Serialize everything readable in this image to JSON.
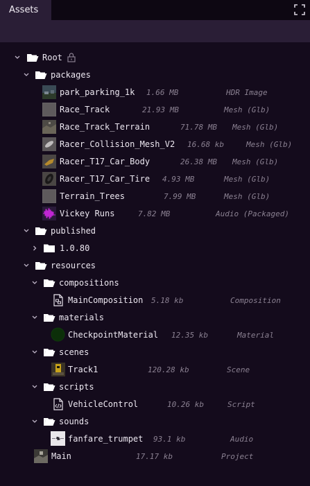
{
  "tab": {
    "label": "Assets"
  },
  "tree": {
    "root": {
      "label": "Root"
    },
    "packages": {
      "label": "packages",
      "items": [
        {
          "name": "park_parking_1k",
          "size": "1.66 MB",
          "type": "HDR Image"
        },
        {
          "name": "Race_Track",
          "size": "21.93 MB",
          "type": "Mesh (Glb)"
        },
        {
          "name": "Race_Track_Terrain",
          "size": "71.78 MB",
          "type": "Mesh (Glb)"
        },
        {
          "name": "Racer_Collision_Mesh_V2",
          "size": "16.68 kb",
          "type": "Mesh (Glb)"
        },
        {
          "name": "Racer_T17_Car_Body",
          "size": "26.38 MB",
          "type": "Mesh (Glb)"
        },
        {
          "name": "Racer_T17_Car_Tire",
          "size": "4.93 MB",
          "type": "Mesh (Glb)"
        },
        {
          "name": "Terrain_Trees",
          "size": "7.99 MB",
          "type": "Mesh (Glb)"
        },
        {
          "name": "Vickey Runs",
          "size": "7.82 MB",
          "type": "Audio (Packaged)"
        }
      ]
    },
    "published": {
      "label": "published",
      "version": "1.0.80"
    },
    "resources": {
      "label": "resources",
      "compositions": {
        "label": "compositions",
        "item": {
          "name": "MainComposition",
          "size": "5.18 kb",
          "type": "Composition"
        }
      },
      "materials": {
        "label": "materials",
        "item": {
          "name": "CheckpointMaterial",
          "size": "12.35 kb",
          "type": "Material"
        }
      },
      "scenes": {
        "label": "scenes",
        "item": {
          "name": "Track1",
          "size": "120.28 kb",
          "type": "Scene"
        }
      },
      "scripts": {
        "label": "scripts",
        "item": {
          "name": "VehicleControl",
          "size": "10.26 kb",
          "type": "Script"
        }
      },
      "sounds": {
        "label": "sounds",
        "item": {
          "name": "fanfare_trumpet",
          "size": "93.1 kb",
          "type": "Audio"
        }
      }
    },
    "main": {
      "name": "Main",
      "size": "17.17 kb",
      "type": "Project"
    }
  }
}
